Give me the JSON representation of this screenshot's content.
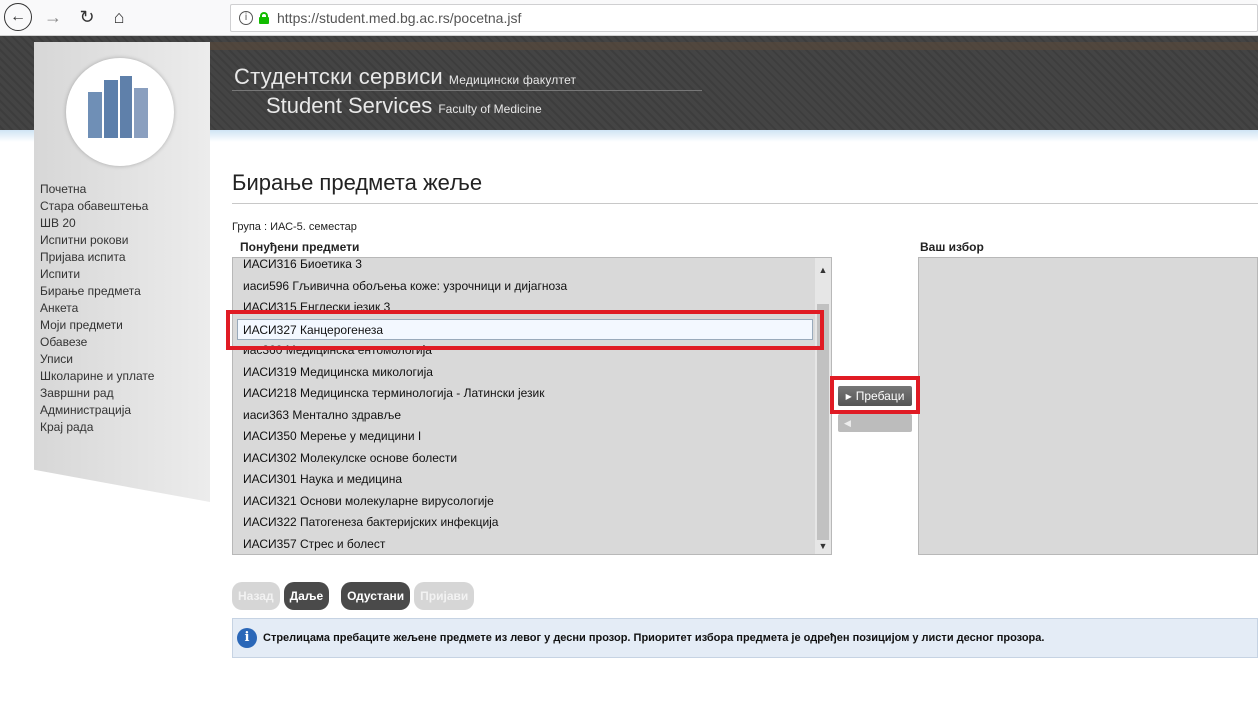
{
  "browser": {
    "url": "https://student.med.bg.ac.rs/pocetna.jsf",
    "back_icon": "←",
    "forward_icon": "→",
    "reload_icon": "↻",
    "home_icon": "⌂",
    "info_icon": "i"
  },
  "header": {
    "title_cyr": "Студентски сервиси",
    "subtitle_cyr": "Медицински факултет",
    "title_lat": "Student Services",
    "subtitle_lat": "Faculty of Medicine"
  },
  "sidebar": {
    "items": [
      {
        "label": "Почетна"
      },
      {
        "label": "Стара обавештења"
      },
      {
        "label": "ШВ 20"
      },
      {
        "label": "Испитни рокови"
      },
      {
        "label": "Пријава испита"
      },
      {
        "label": "Испити"
      },
      {
        "label": "Бирање предмета"
      },
      {
        "label": "Анкета"
      },
      {
        "label": "Моји предмети"
      },
      {
        "label": "Обавезе"
      },
      {
        "label": "Уписи"
      },
      {
        "label": "Школарине и уплате"
      },
      {
        "label": "Завршни рад"
      },
      {
        "label": "Администрација"
      },
      {
        "label": "Крај рада"
      }
    ]
  },
  "main": {
    "page_title": "Бирање предмета жеље",
    "group_label": "Група : ИАС-5. семестар",
    "offered_label": "Понуђени предмети",
    "your_choice_label": "Ваш избор",
    "offered_items": [
      "ИАСИ316 Биоетика 3",
      "иаси596 Гљивична обољења коже: узрочници и дијагноза",
      "ИАСИ315 Енглески језик 3",
      "ИАСИ327 Канцерогенеза",
      "иас360 Медицинска ентомологија",
      "ИАСИ319 Медицинска микологија",
      "ИАСИ218 Медицинска терминологија - Латински језик",
      "иаси363 Ментално здравље",
      "ИАСИ350 Мерење у медицини I",
      "ИАСИ302 Молекулске основе болести",
      "ИАСИ301 Наука и медицина",
      "ИАСИ321 Основи молекуларне вирусологије",
      "ИАСИ322 Патогенеза бактеријских инфекција",
      "ИАСИ357 Стрес и болест"
    ],
    "selected_index": 3,
    "transfer_label": "Пребаци",
    "buttons": {
      "back": "Назад",
      "next": "Даље",
      "cancel": "Одустани",
      "submit": "Пријави"
    },
    "info_text": "Стрелицама пребаците жељене предмете из левог у десни прозор. Приоритет избора предмета је одређен позицијом у листи десног прозора."
  },
  "colors": {
    "highlight": "#e01b24",
    "header_bg": "#404040",
    "info_icon": "#2a67b8"
  }
}
